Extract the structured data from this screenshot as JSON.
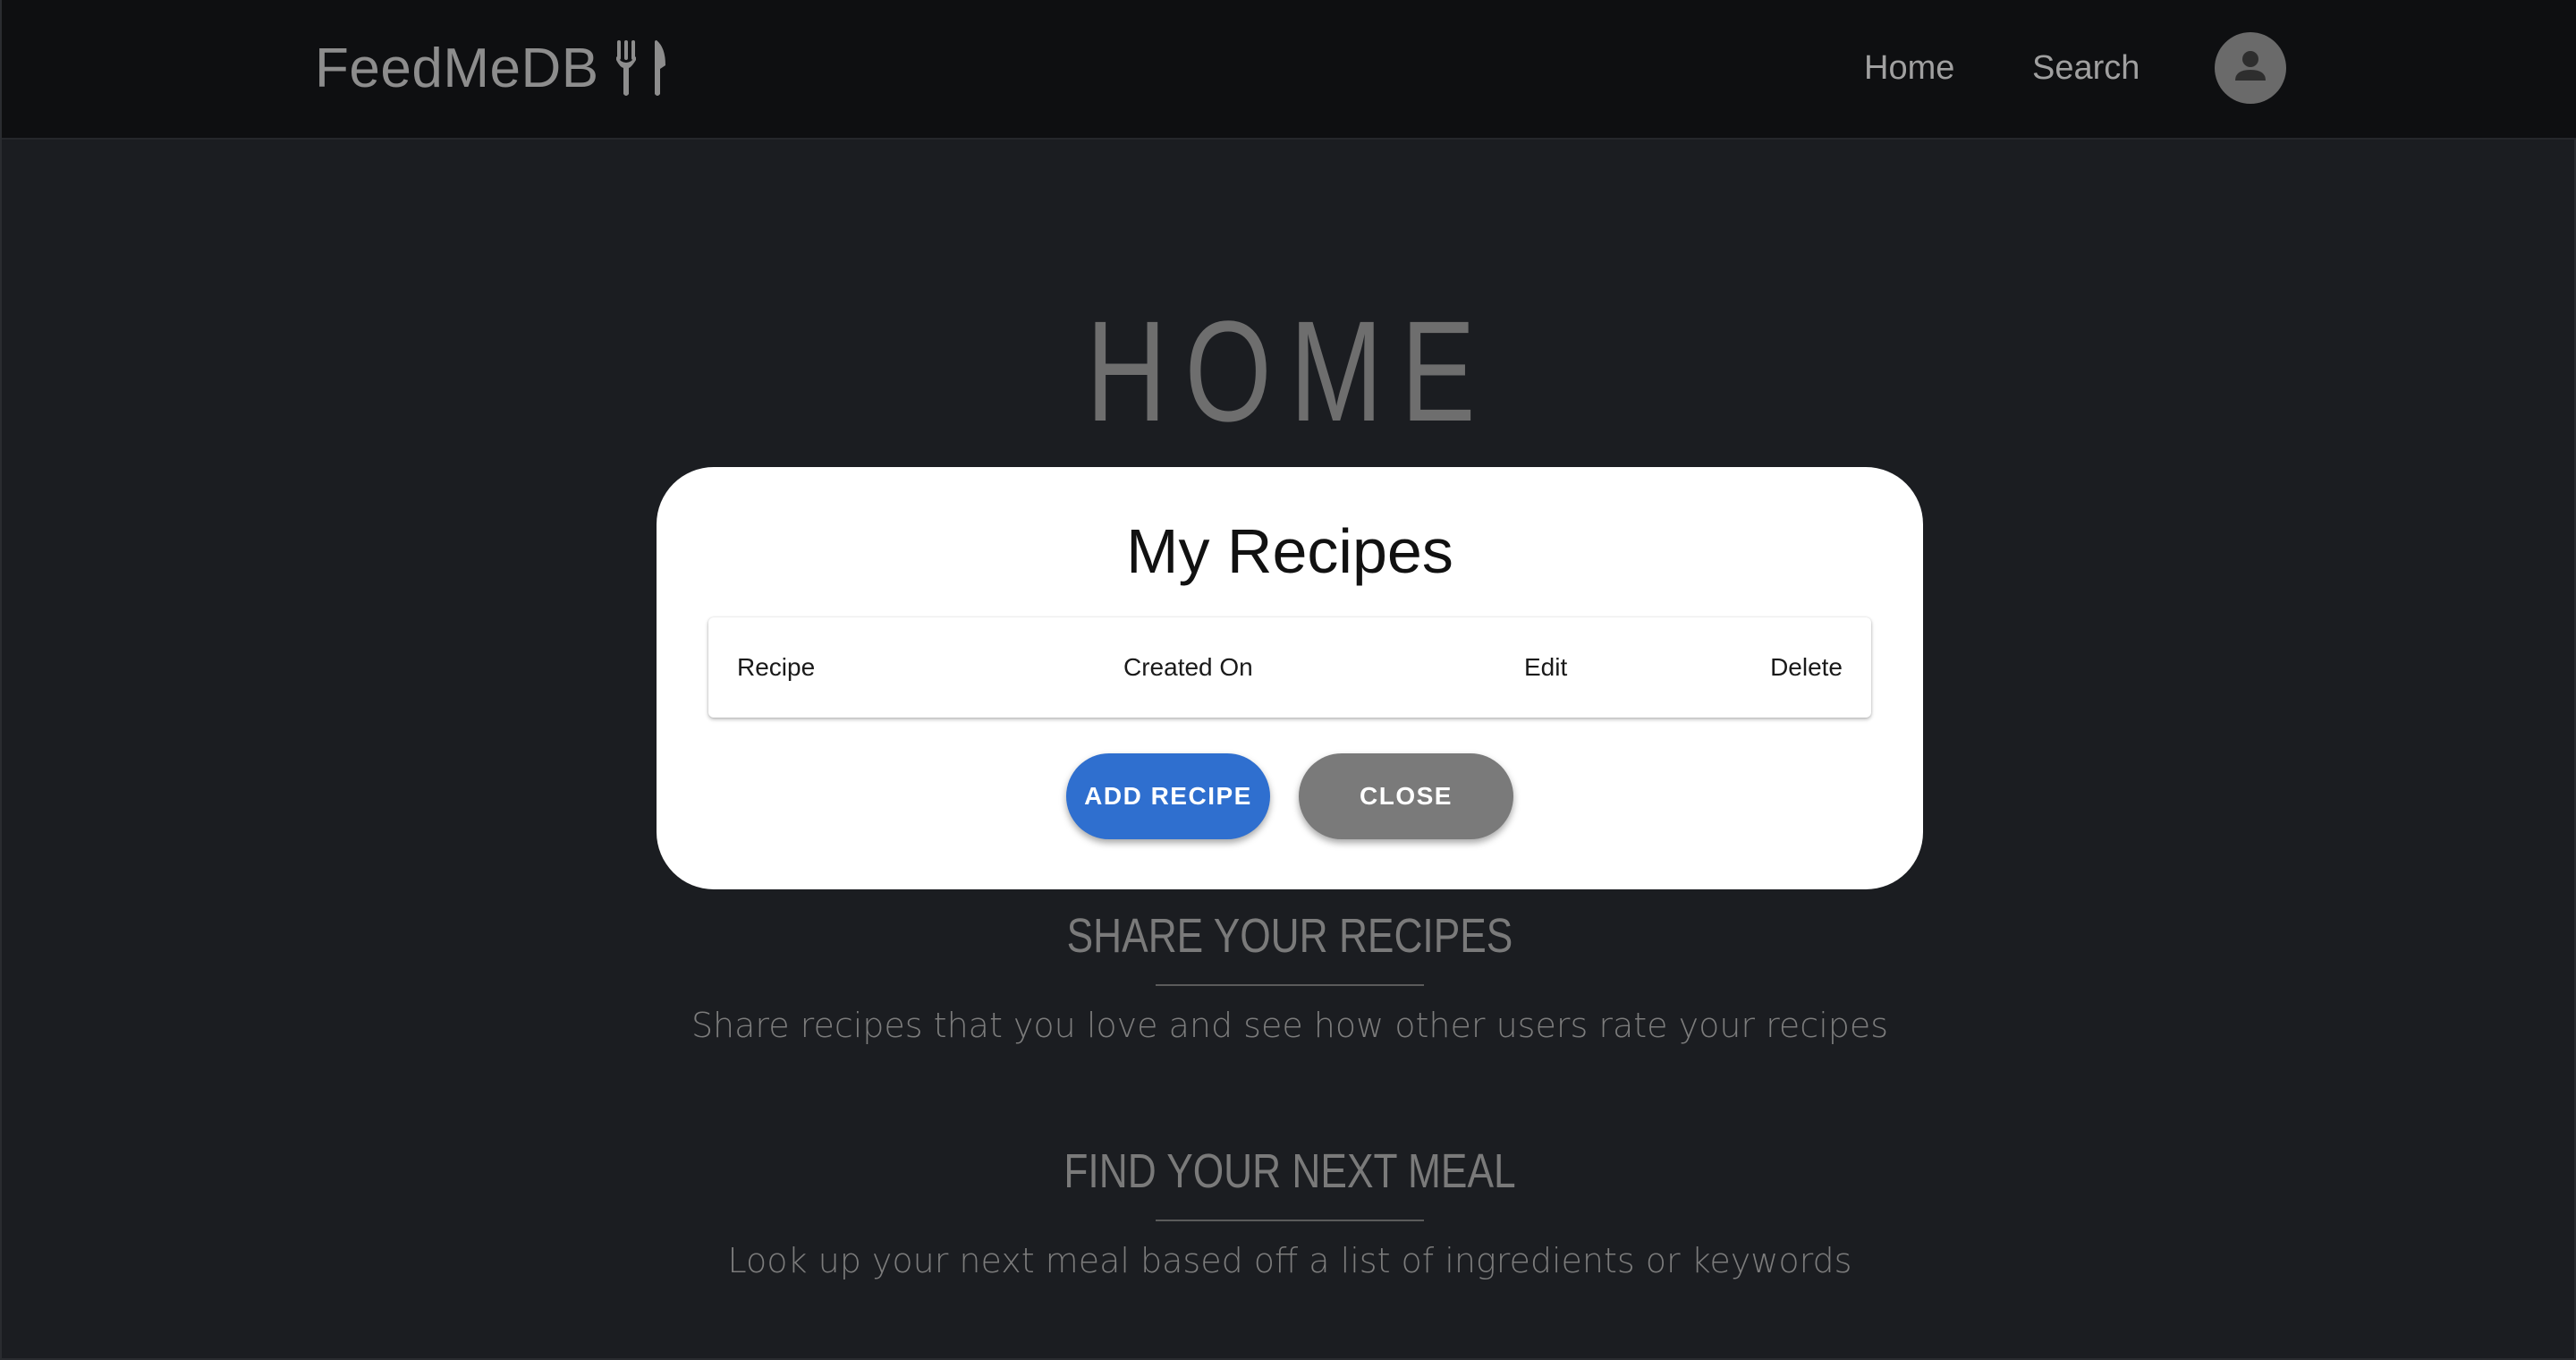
{
  "navbar": {
    "brand": "FeedMeDB",
    "brand_icon": "cutlery-icon",
    "links": {
      "home": "Home",
      "search": "Search"
    },
    "avatar_icon": "user-icon"
  },
  "hero": {
    "title": "HOME"
  },
  "sections": [
    {
      "heading": "SHARE YOUR RECIPES",
      "text": "Share recipes that you love and see how other users rate your recipes"
    },
    {
      "heading": "FIND YOUR NEXT MEAL",
      "text": "Look up your next meal based off a list of ingredients or keywords"
    }
  ],
  "modal": {
    "title": "My Recipes",
    "table": {
      "columns": [
        "Recipe",
        "Created On",
        "Edit",
        "Delete"
      ]
    },
    "buttons": {
      "add": "ADD RECIPE",
      "close": "CLOSE"
    }
  },
  "colors": {
    "background": "#1b1d21",
    "navbar": "#0e0f11",
    "primary": "#2f6fcf",
    "secondary": "#7a7a7a"
  }
}
